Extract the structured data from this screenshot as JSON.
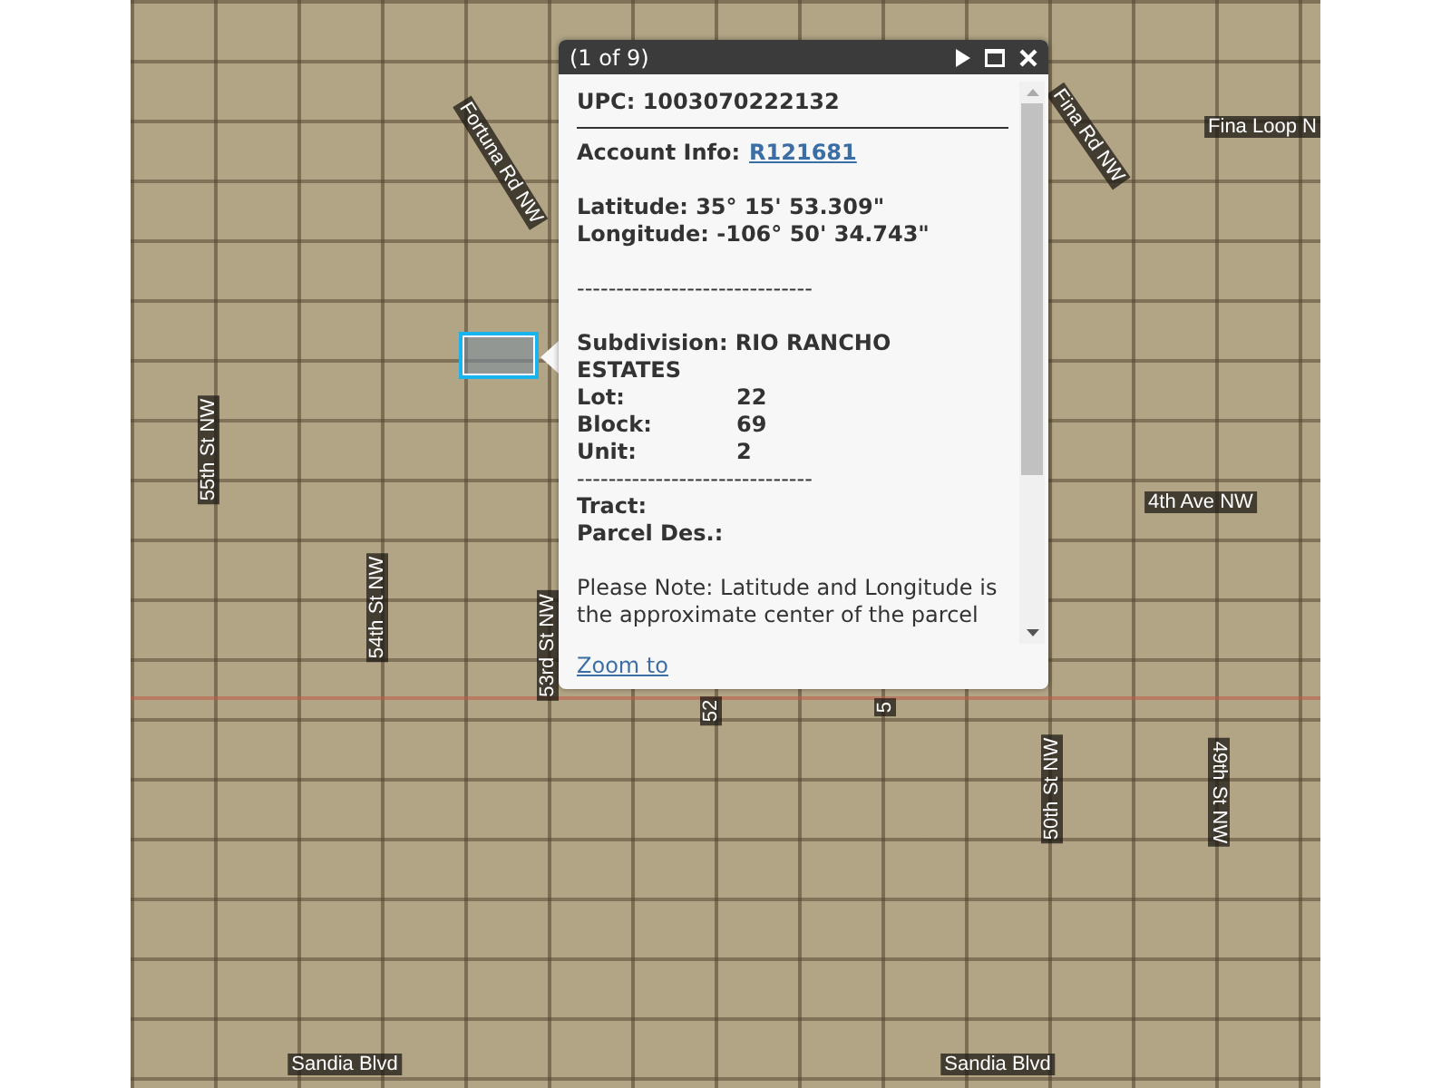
{
  "map": {
    "labels": [
      {
        "text": "Fortuna Rd NW",
        "kind": "diagonal"
      },
      {
        "text": "Fina Rd NW",
        "kind": "diagonal"
      },
      {
        "text": "Fina Loop N",
        "kind": "horizontal"
      },
      {
        "text": "55th St NW",
        "kind": "up"
      },
      {
        "text": "4th Ave NW",
        "kind": "horizontal"
      },
      {
        "text": "54th St NW",
        "kind": "up"
      },
      {
        "text": "53rd St NW",
        "kind": "up"
      },
      {
        "text": "52",
        "kind": "up"
      },
      {
        "text": "5",
        "kind": "up"
      },
      {
        "text": "50th St NW",
        "kind": "up"
      },
      {
        "text": "49th St NW",
        "kind": "down"
      },
      {
        "text": "Sandia Blvd",
        "kind": "horizontal"
      },
      {
        "text": "Sandia Blvd",
        "kind": "horizontal"
      }
    ]
  },
  "popup": {
    "title": "(1 of 9)",
    "lines": [
      {
        "kind": "field",
        "label": "UPC:",
        "value": "1003070222132"
      },
      {
        "kind": "rule"
      },
      {
        "kind": "link_field",
        "label": "Account Info:",
        "value": "R121681"
      },
      {
        "kind": "gap"
      },
      {
        "kind": "field",
        "label": "Latitude:",
        "value": "35° 15' 53.309\""
      },
      {
        "kind": "field",
        "label": "Longitude:",
        "value": "-106° 50' 34.743\""
      },
      {
        "kind": "gap"
      },
      {
        "kind": "dashes",
        "text": "------------------------------"
      },
      {
        "kind": "gap"
      },
      {
        "kind": "field",
        "label": "Subdivision:",
        "value": "RIO RANCHO ESTATES"
      },
      {
        "kind": "column",
        "label": "Lot:",
        "value": "22"
      },
      {
        "kind": "column",
        "label": "Block:",
        "value": "69"
      },
      {
        "kind": "column",
        "label": "Unit:",
        "value": "2"
      },
      {
        "kind": "dashes",
        "text": "------------------------------"
      },
      {
        "kind": "field",
        "label": "Tract:"
      },
      {
        "kind": "field",
        "label": "Parcel Des.:"
      },
      {
        "kind": "gap"
      },
      {
        "kind": "note",
        "text": "Please Note: Latitude and Longitude is the approximate center of the parcel"
      }
    ],
    "action": "Zoom to"
  }
}
